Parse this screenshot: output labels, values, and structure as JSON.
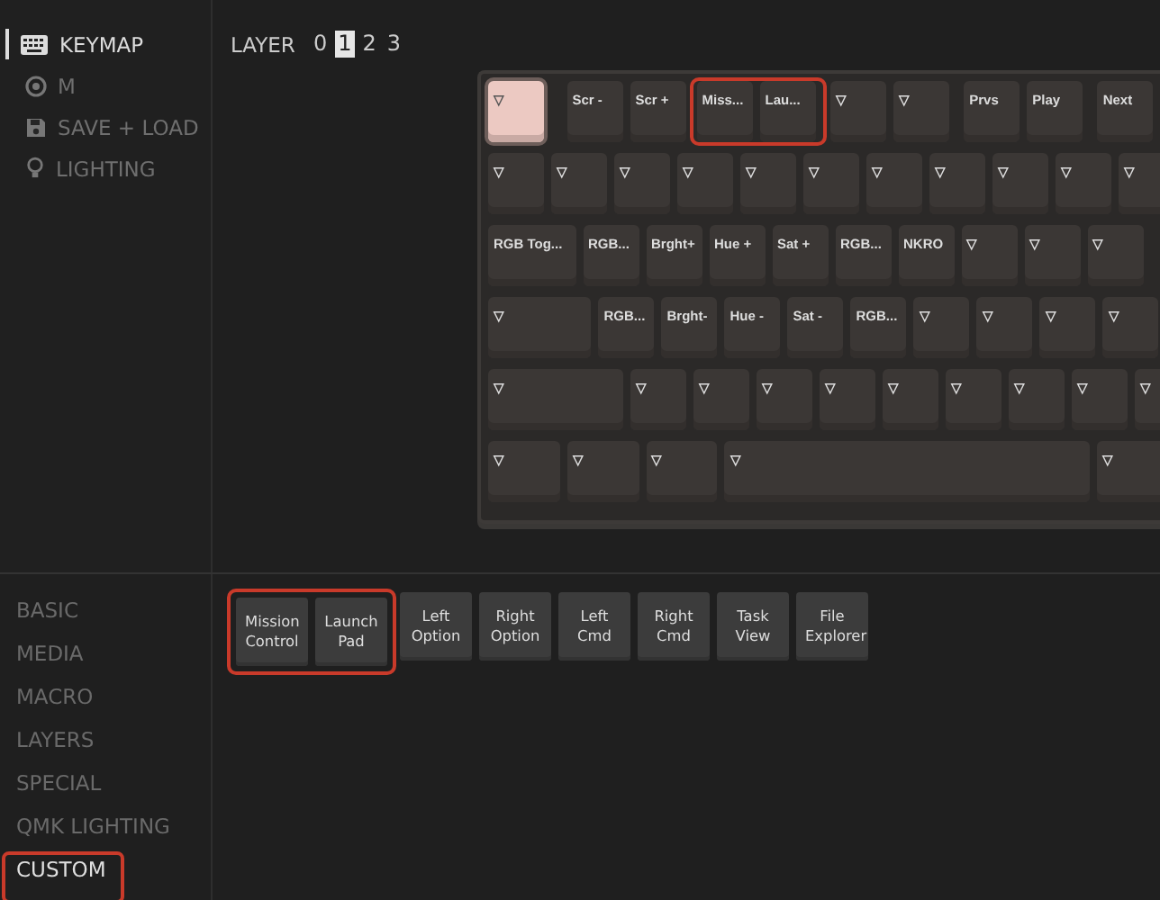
{
  "nav": [
    {
      "label": "KEYMAP",
      "selected": true
    },
    {
      "label": "M",
      "selected": false
    },
    {
      "label": "SAVE + LOAD",
      "selected": false
    },
    {
      "label": "LIGHTING",
      "selected": false
    }
  ],
  "layers": {
    "label": "LAYER",
    "items": [
      {
        "label": "0",
        "selected": false
      },
      {
        "label": "1",
        "selected": true
      },
      {
        "label": "2",
        "selected": false
      },
      {
        "label": "3",
        "selected": false
      }
    ]
  },
  "keyboard": {
    "rows": [
      [
        {
          "label": "▽",
          "selected": true,
          "marked": false
        },
        {
          "label": "Scr -",
          "selected": false,
          "marked": false
        },
        {
          "label": "Scr +",
          "selected": false,
          "marked": false
        },
        {
          "label": "Miss...",
          "selected": false,
          "marked": true
        },
        {
          "label": "Lau...",
          "selected": false,
          "marked": true
        },
        {
          "label": "▽",
          "selected": false,
          "marked": false
        },
        {
          "label": "▽",
          "selected": false,
          "marked": false
        },
        {
          "label": "Prvs",
          "selected": false,
          "marked": false
        },
        {
          "label": "Play",
          "selected": false,
          "marked": false
        },
        {
          "label": "Next",
          "selected": false,
          "marked": false
        }
      ],
      [
        {
          "label": "▽",
          "selected": false,
          "marked": false
        },
        {
          "label": "▽",
          "selected": false,
          "marked": false
        },
        {
          "label": "▽",
          "selected": false,
          "marked": false
        },
        {
          "label": "▽",
          "selected": false,
          "marked": false
        },
        {
          "label": "▽",
          "selected": false,
          "marked": false
        },
        {
          "label": "▽",
          "selected": false,
          "marked": false
        },
        {
          "label": "▽",
          "selected": false,
          "marked": false
        },
        {
          "label": "▽",
          "selected": false,
          "marked": false
        },
        {
          "label": "▽",
          "selected": false,
          "marked": false
        },
        {
          "label": "▽",
          "selected": false,
          "marked": false
        },
        {
          "label": "▽",
          "selected": false,
          "marked": false
        }
      ],
      [
        {
          "label": "RGB Tog...",
          "selected": false,
          "marked": false
        },
        {
          "label": "RGB...",
          "selected": false,
          "marked": false
        },
        {
          "label": "Brght+",
          "selected": false,
          "marked": false
        },
        {
          "label": "Hue +",
          "selected": false,
          "marked": false
        },
        {
          "label": "Sat +",
          "selected": false,
          "marked": false
        },
        {
          "label": "RGB...",
          "selected": false,
          "marked": false
        },
        {
          "label": "NKRO",
          "selected": false,
          "marked": false
        },
        {
          "label": "▽",
          "selected": false,
          "marked": false
        },
        {
          "label": "▽",
          "selected": false,
          "marked": false
        },
        {
          "label": "▽",
          "selected": false,
          "marked": false
        }
      ],
      [
        {
          "label": "▽",
          "selected": false,
          "marked": false
        },
        {
          "label": "RGB...",
          "selected": false,
          "marked": false
        },
        {
          "label": "Brght-",
          "selected": false,
          "marked": false
        },
        {
          "label": "Hue -",
          "selected": false,
          "marked": false
        },
        {
          "label": "Sat -",
          "selected": false,
          "marked": false
        },
        {
          "label": "RGB...",
          "selected": false,
          "marked": false
        },
        {
          "label": "▽",
          "selected": false,
          "marked": false
        },
        {
          "label": "▽",
          "selected": false,
          "marked": false
        },
        {
          "label": "▽",
          "selected": false,
          "marked": false
        },
        {
          "label": "▽",
          "selected": false,
          "marked": false
        }
      ],
      [
        {
          "label": "▽",
          "selected": false,
          "marked": false
        },
        {
          "label": "▽",
          "selected": false,
          "marked": false
        },
        {
          "label": "▽",
          "selected": false,
          "marked": false
        },
        {
          "label": "▽",
          "selected": false,
          "marked": false
        },
        {
          "label": "▽",
          "selected": false,
          "marked": false
        },
        {
          "label": "▽",
          "selected": false,
          "marked": false
        },
        {
          "label": "▽",
          "selected": false,
          "marked": false
        },
        {
          "label": "▽",
          "selected": false,
          "marked": false
        },
        {
          "label": "▽",
          "selected": false,
          "marked": false
        },
        {
          "label": "▽",
          "selected": false,
          "marked": false
        }
      ],
      [
        {
          "label": "▽",
          "selected": false,
          "marked": false
        },
        {
          "label": "▽",
          "selected": false,
          "marked": false
        },
        {
          "label": "▽",
          "selected": false,
          "marked": false
        },
        {
          "label": "▽",
          "selected": false,
          "marked": false
        },
        {
          "label": "▽",
          "selected": false,
          "marked": false
        }
      ]
    ]
  },
  "categories": [
    {
      "label": "BASIC",
      "selected": false,
      "marked": false
    },
    {
      "label": "MEDIA",
      "selected": false,
      "marked": false
    },
    {
      "label": "MACRO",
      "selected": false,
      "marked": false
    },
    {
      "label": "LAYERS",
      "selected": false,
      "marked": false
    },
    {
      "label": "SPECIAL",
      "selected": false,
      "marked": false
    },
    {
      "label": "QMK LIGHTING",
      "selected": false,
      "marked": false
    },
    {
      "label": "CUSTOM",
      "selected": true,
      "marked": true
    }
  ],
  "custom_keys": [
    {
      "label": "Mission Control",
      "marked": true
    },
    {
      "label": "Launch Pad",
      "marked": true
    },
    {
      "label": "Left Option",
      "marked": false
    },
    {
      "label": "Right Option",
      "marked": false
    },
    {
      "label": "Left Cmd",
      "marked": false
    },
    {
      "label": "Right Cmd",
      "marked": false
    },
    {
      "label": "Task View",
      "marked": false
    },
    {
      "label": "File Explorer",
      "marked": false
    }
  ]
}
